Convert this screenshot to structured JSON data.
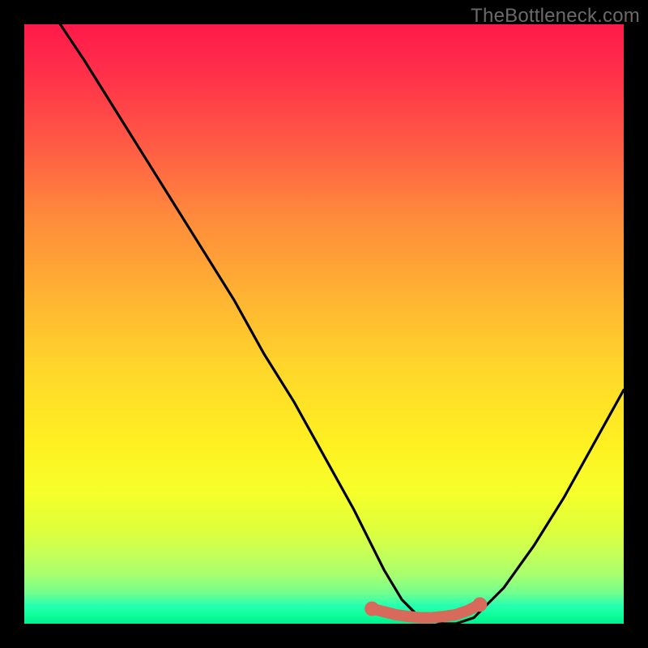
{
  "watermark": "TheBottleneck.com",
  "chart_data": {
    "type": "line",
    "title": "",
    "xlabel": "",
    "ylabel": "",
    "xlim": [
      0,
      100
    ],
    "ylim": [
      0,
      100
    ],
    "series": [
      {
        "name": "bottleneck-curve",
        "x": [
          6,
          10,
          15,
          20,
          25,
          30,
          35,
          40,
          45,
          50,
          55,
          58,
          60,
          63,
          66,
          70,
          72,
          75,
          80,
          85,
          90,
          95,
          100
        ],
        "values": [
          100,
          94,
          86,
          78,
          70,
          62,
          54,
          45,
          37,
          28,
          19,
          13,
          9,
          4,
          1,
          0,
          0,
          1,
          6,
          13,
          21,
          30,
          39
        ]
      },
      {
        "name": "sweet-spot-marker",
        "x": [
          58,
          60,
          62,
          64,
          66,
          68,
          70,
          72,
          74,
          76
        ],
        "values": [
          2.5,
          2.0,
          1.5,
          1.2,
          1.0,
          1.0,
          1.2,
          1.5,
          2.2,
          3.2
        ]
      }
    ],
    "colors": {
      "curve": "#000000",
      "marker": "#d86a5c",
      "gradient_top": "#ff1a4a",
      "gradient_bottom": "#00f090"
    }
  }
}
